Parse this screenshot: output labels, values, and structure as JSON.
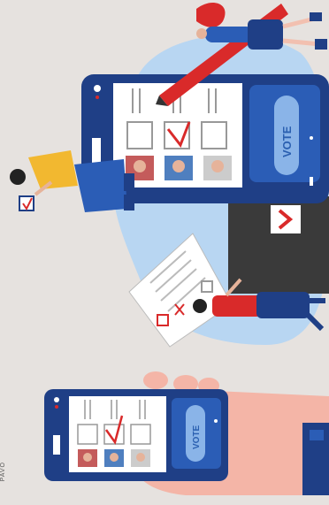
{
  "illustration": {
    "large_phone_button_label": "VOTE",
    "small_phone_button_label": "VOTE",
    "corner_caption": "PAVO"
  },
  "colors": {
    "background": "#e6e2df",
    "phone_body": "#1f3f86",
    "screen": "#ffffff",
    "vote_button": "#8ab4e8",
    "check_red": "#d92a2a",
    "blob": "#b8d6f2",
    "ballot_box": "#3a3a3a"
  }
}
